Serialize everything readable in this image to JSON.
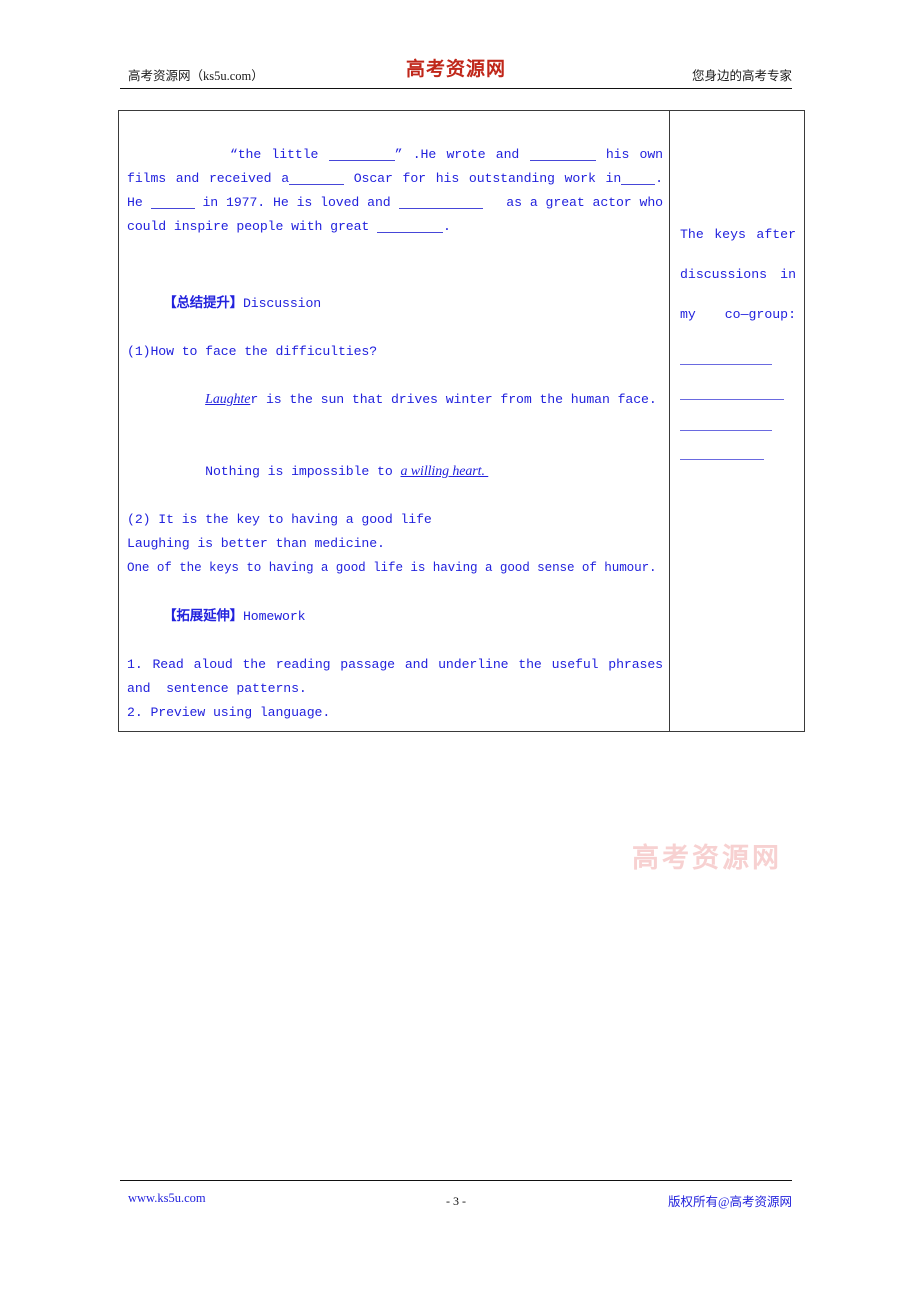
{
  "colors": {
    "ink_blue": "#2222dd",
    "logo_red": "#c0271a",
    "watermark_pink": "#f6c9c9",
    "border": "#3a3a3a"
  },
  "header": {
    "left": "高考资源网（ks5u.com）",
    "logo": "高考资源网",
    "right": "您身边的高考专家"
  },
  "main_cell": {
    "cloze": {
      "line1_a": "“the little ",
      "line1_b": "” .He wrote and ",
      "line1_c": " his own films and received a",
      "line1_d": " Oscar for his outstanding work in",
      "line1_e": ". He ",
      "line1_f": " in 1977. He is loved and ",
      "line1_g": "   as a great actor who could inspire people with great ",
      "line1_h": "."
    },
    "section_discussion": {
      "tag": "【总结提升】",
      "label": "Discussion",
      "q1": "(1)How to face the difficulties?",
      "a1_italic": "Laughte",
      "a1_rest": "r is the sun that drives winter from the human face.",
      "a2_pre": "Nothing is impossible to ",
      "a2_italic": "a willing heart. ",
      "q2": "(2) It is the key to having a good life",
      "a3": "Laughing is better than medicine.",
      "a4": "One of the keys to having a good life is having a good sense of humour."
    },
    "section_homework": {
      "tag": "【拓展延伸】",
      "label": "Homework",
      "item1": "1. Read aloud the reading passage and underline the useful phrases and  sentence patterns.",
      "item2": "2. Preview using language."
    }
  },
  "side_cell": {
    "note": "The keys after discussions in my co—group:",
    "blank_lines": [
      "",
      "",
      "",
      ""
    ]
  },
  "watermark": "高考资源网",
  "footer": {
    "left": "www.ks5u.com",
    "center": "- 3 -",
    "right": "版权所有@高考资源网"
  }
}
